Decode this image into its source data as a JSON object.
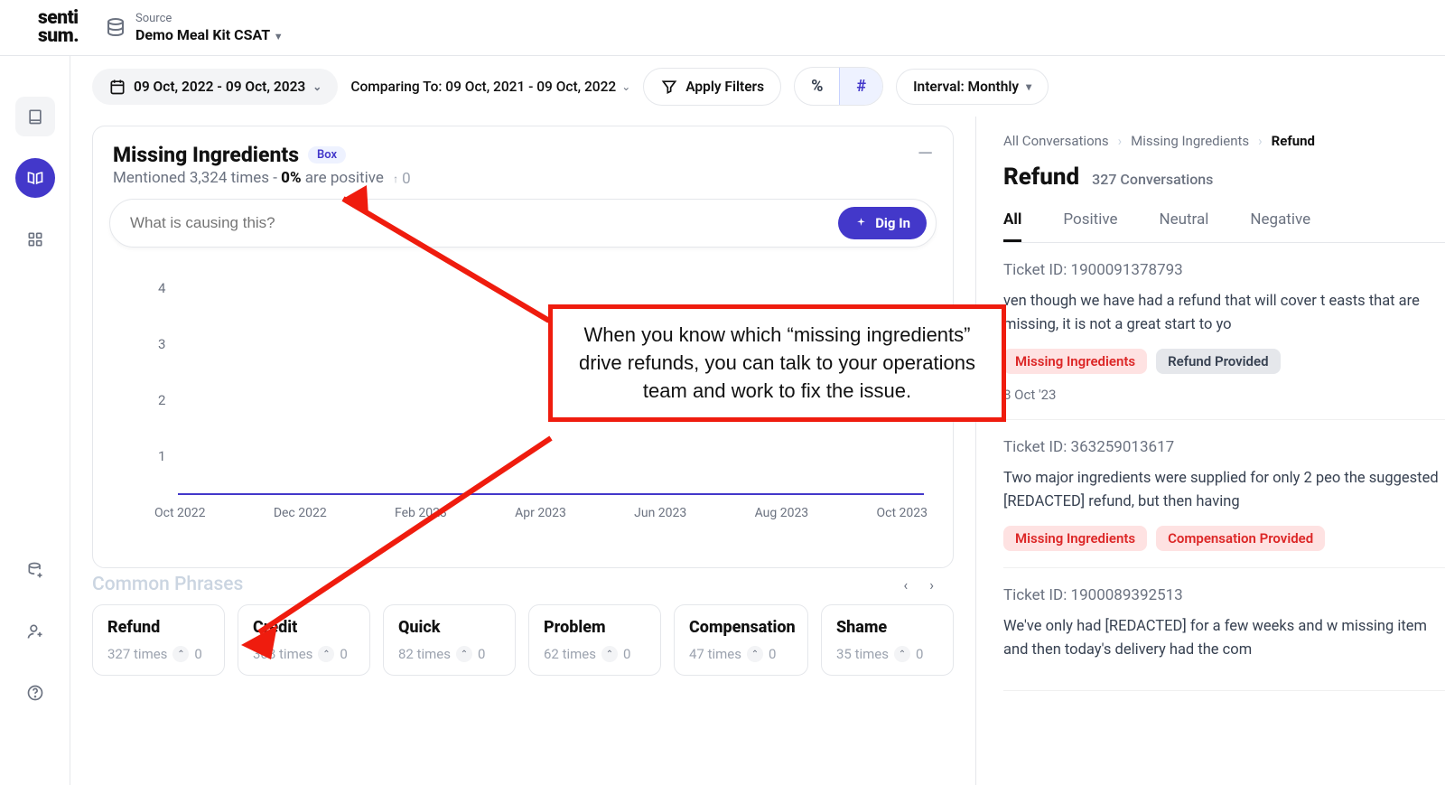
{
  "brand": "senti\nsum.",
  "source": {
    "label": "Source",
    "name": "Demo Meal Kit CSAT"
  },
  "filters": {
    "date_range": "09 Oct, 2022 - 09 Oct, 2023",
    "comparing": "Comparing To: 09 Oct, 2021 - 09 Oct, 2022",
    "apply": "Apply Filters",
    "percent": "%",
    "hash": "#",
    "interval": "Interval: Monthly"
  },
  "topic": {
    "title": "Missing Ingredients",
    "badge": "Box",
    "mentions_prefix": "Mentioned 3,324 times - ",
    "pct": "0%",
    "mentions_suffix": " are positive",
    "delta": "0",
    "search_placeholder": "What is causing this?",
    "digin": "Dig In"
  },
  "chart_data": {
    "type": "line",
    "categories": [
      "Oct 2022",
      "Dec 2022",
      "Feb 2023",
      "Apr 2023",
      "Jun 2023",
      "Aug 2023",
      "Oct 2023"
    ],
    "values": [
      0,
      0,
      0,
      0,
      0,
      0,
      0
    ],
    "ylabels": [
      "4",
      "3",
      "2",
      "1"
    ],
    "ylim": [
      0,
      4
    ]
  },
  "phrases": {
    "title": "Common Phrases",
    "items": [
      {
        "name": "Refund",
        "times": "327 times",
        "delta": "0"
      },
      {
        "name": "Credit",
        "times": "308 times",
        "delta": "0"
      },
      {
        "name": "Quick",
        "times": "82 times",
        "delta": "0"
      },
      {
        "name": "Problem",
        "times": "62 times",
        "delta": "0"
      },
      {
        "name": "Compensation",
        "times": "47 times",
        "delta": "0"
      },
      {
        "name": "Shame",
        "times": "35 times",
        "delta": "0"
      }
    ]
  },
  "panel": {
    "crumbs": [
      "All Conversations",
      "Missing Ingredients",
      "Refund"
    ],
    "title": "Refund",
    "count": "327 Conversations",
    "tabs": [
      "All",
      "Positive",
      "Neutral",
      "Negative"
    ],
    "active_tab": "All",
    "tickets": [
      {
        "id": "Ticket ID: 1900091378793",
        "body": "ven though we have had a refund that will cover t easts that are missing, it is not a great start to yo",
        "tags": [
          {
            "t": "Missing Ingredients",
            "c": "red"
          },
          {
            "t": "Refund Provided",
            "c": "gray"
          }
        ],
        "date": "8 Oct '23"
      },
      {
        "id": "Ticket ID: 363259013617",
        "body": "Two major ingredients were supplied for only 2 peo the suggested [REDACTED] refund, but then having",
        "tags": [
          {
            "t": "Missing Ingredients",
            "c": "red"
          },
          {
            "t": "Compensation Provided",
            "c": "red"
          }
        ],
        "date": ""
      },
      {
        "id": "Ticket ID: 1900089392513",
        "body": "We've only had [REDACTED] for a few weeks and w missing item and then today's delivery had the com",
        "tags": [],
        "date": ""
      }
    ]
  },
  "annotation": "When you know which “missing ingredients” drive refunds, you can talk to your operations team and work to fix the issue."
}
